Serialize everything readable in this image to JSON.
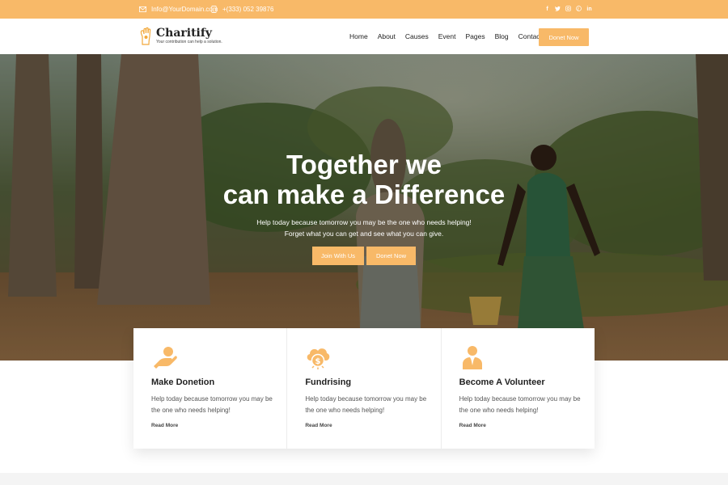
{
  "topbar": {
    "email": "Info@YourDomain.com",
    "phone": "+(333) 052 39876",
    "socials": [
      "facebook-icon",
      "twitter-icon",
      "instagram-icon",
      "pinterest-icon",
      "linkedin-icon"
    ]
  },
  "header": {
    "brand": "Charitify",
    "tagline": "Your contribution can help a solution.",
    "nav": [
      "Home",
      "About",
      "Causes",
      "Event",
      "Pages",
      "Blog",
      "Contact"
    ],
    "donate_label": "Donet Now"
  },
  "hero": {
    "title_line1": "Together we",
    "title_line2": "can make a Difference",
    "subtitle_line1": "Help today because tomorrow you may be the one who needs helping!",
    "subtitle_line2": "Forget what you can get and see what you can give.",
    "join_label": "Join With Us",
    "donate_label": "Donet Now"
  },
  "cards": [
    {
      "icon": "donation-hand-icon",
      "title": "Make Donetion",
      "desc": "Help today because tomorrow you may be the one who needs helping!",
      "more": "Read More"
    },
    {
      "icon": "fundraising-icon",
      "title": "Fundrising",
      "desc": "Help today because tomorrow you may be the one who needs helping!",
      "more": "Read More"
    },
    {
      "icon": "volunteer-icon",
      "title": "Become A Volunteer",
      "desc": "Help today because tomorrow you may be the one who needs helping!",
      "more": "Read More"
    }
  ],
  "colors": {
    "accent": "#f8b968",
    "text_dark": "#222222",
    "text_muted": "#555555"
  }
}
